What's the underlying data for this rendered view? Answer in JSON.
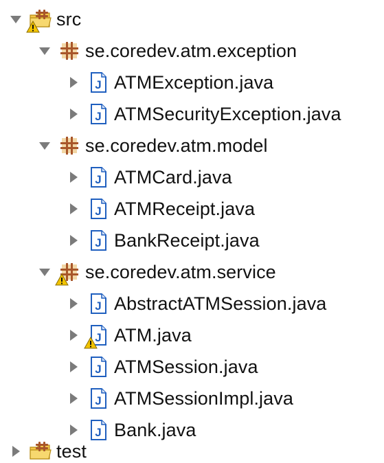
{
  "tree": {
    "src": {
      "label": "src",
      "icon": "source-folder-icon",
      "expanded": true,
      "warning": true
    },
    "packages": [
      {
        "label": "se.coredev.atm.exception",
        "icon": "package-icon",
        "expanded": true,
        "warning": false,
        "files": [
          {
            "label": "ATMException.java",
            "icon": "java-file-icon",
            "warning": false
          },
          {
            "label": "ATMSecurityException.java",
            "icon": "java-file-icon",
            "warning": false
          }
        ]
      },
      {
        "label": "se.coredev.atm.model",
        "icon": "package-icon",
        "expanded": true,
        "warning": false,
        "files": [
          {
            "label": "ATMCard.java",
            "icon": "java-file-icon",
            "warning": false
          },
          {
            "label": "ATMReceipt.java",
            "icon": "java-file-icon",
            "warning": false
          },
          {
            "label": "BankReceipt.java",
            "icon": "java-file-icon",
            "warning": false
          }
        ]
      },
      {
        "label": "se.coredev.atm.service",
        "icon": "package-icon",
        "expanded": true,
        "warning": true,
        "files": [
          {
            "label": "AbstractATMSession.java",
            "icon": "java-file-icon",
            "warning": false
          },
          {
            "label": "ATM.java",
            "icon": "java-file-icon",
            "warning": true
          },
          {
            "label": "ATMSession.java",
            "icon": "java-file-icon",
            "warning": false
          },
          {
            "label": "ATMSessionImpl.java",
            "icon": "java-file-icon",
            "warning": false
          },
          {
            "label": "Bank.java",
            "icon": "java-file-icon",
            "warning": false
          }
        ]
      }
    ],
    "test": {
      "label": "test",
      "icon": "source-folder-icon",
      "expanded": false,
      "warning": false
    }
  },
  "colors": {
    "twisty": "#7b7b7b",
    "folder": "#f3c74a",
    "package_brown": "#a8562a",
    "package_fill": "#f2d7a6",
    "java_blue": "#1f5fbf",
    "warning_yellow": "#f2c400"
  }
}
